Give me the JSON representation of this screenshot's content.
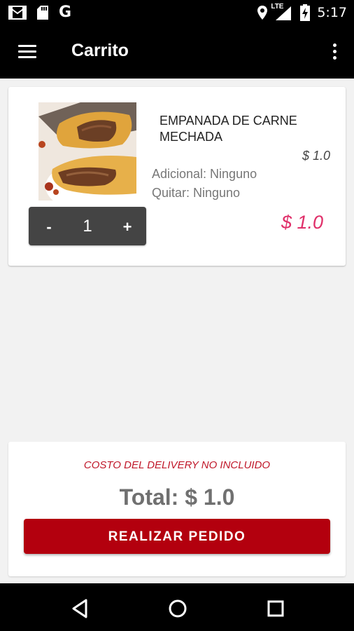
{
  "status_bar": {
    "time": "5:17",
    "network_label": "LTE",
    "left_icons": [
      "gmail-icon",
      "sd-card-icon",
      "google-icon"
    ],
    "google_glyph": "G",
    "right_icons": [
      "location-icon",
      "signal-icon",
      "battery-charging-icon"
    ]
  },
  "app_bar": {
    "title": "Carrito",
    "menu_icon": "hamburger-menu-icon",
    "overflow_icon": "more-vert-icon"
  },
  "cart_item": {
    "name": "EMPANADA DE CARNE MECHADA",
    "unit_price": "$ 1.0",
    "additional": "Adicional: Ninguno",
    "remove": "Quitar: Ninguno",
    "qty_minus": "-",
    "qty_value": "1",
    "qty_plus": "+",
    "line_total": "$ 1.0"
  },
  "summary": {
    "delivery_note": "COSTO DEL DELIVERY NO INCLUIDO",
    "total": "Total: $ 1.0",
    "order_button": "REALIZAR PEDIDO"
  },
  "nav_bar": {
    "icons": [
      "back-icon",
      "home-icon",
      "recents-icon"
    ]
  },
  "colors": {
    "bar_background": "#000000",
    "page_background": "#f2f2f2",
    "accent_red": "#b3000e",
    "price_pink": "#e0306a",
    "delivery_red": "#c0182a",
    "qty_box": "#444444"
  }
}
